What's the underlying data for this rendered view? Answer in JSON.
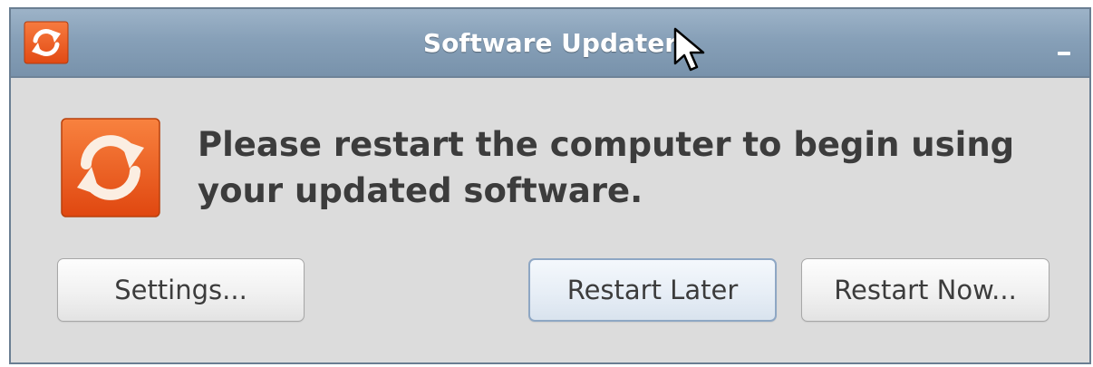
{
  "window": {
    "title": "Software Updater"
  },
  "titlebar": {
    "app_icon": "refresh-icon",
    "minimize_icon": "minimize-icon"
  },
  "dialog": {
    "icon": "refresh-icon",
    "message": "Please restart the computer to begin using your updated software."
  },
  "buttons": {
    "settings_label": "Settings...",
    "restart_later_label": "Restart Later",
    "restart_now_label": "Restart Now..."
  },
  "cursor": {
    "icon": "mouse-pointer-icon"
  },
  "colors": {
    "titlebar": "#87a0b8",
    "window_background": "#dcdcdc",
    "icon_orange": "#f15a22",
    "text": "#3c3c3c",
    "focused_button_border": "#8ea7c4"
  }
}
